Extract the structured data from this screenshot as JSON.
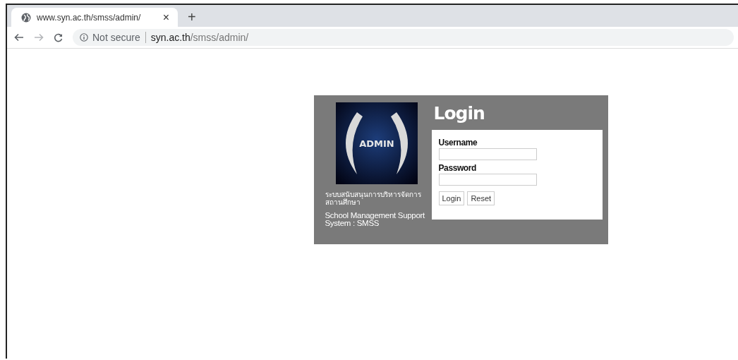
{
  "browser": {
    "tab": {
      "title": "www.syn.ac.th/smss/admin/",
      "close": "×"
    },
    "new_tab": "+",
    "security": "Not secure",
    "url_host": "syn.ac.th",
    "url_path": "/smss/admin/"
  },
  "login_panel": {
    "logo_text": "ADMIN",
    "thai_lines": [
      "ระบบสนับสนุนการบริหารจัดการ",
      "สถานศึกษา"
    ],
    "system_name_lines": [
      "School Management Support",
      "System : SMSS"
    ],
    "title": "Login",
    "fields": [
      {
        "label": "Username"
      },
      {
        "label": "Password"
      }
    ],
    "buttons": [
      "Login",
      "Reset"
    ]
  }
}
